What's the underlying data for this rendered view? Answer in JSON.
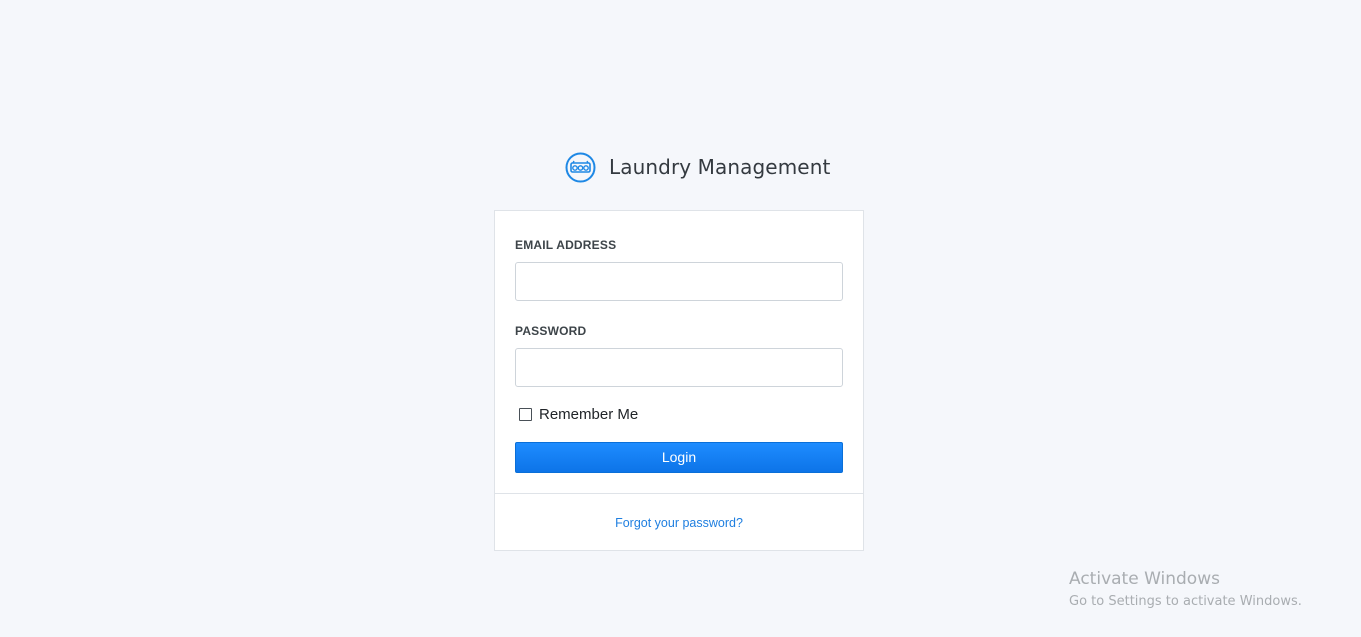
{
  "brand": {
    "title": "Laundry Management",
    "logo_icon": "washing-machine-icon",
    "accent_color": "#1e88e5"
  },
  "login_form": {
    "email_label": "EMAIL ADDRESS",
    "email_value": "",
    "password_label": "PASSWORD",
    "password_value": "",
    "remember_label": "Remember Me",
    "remember_checked": false,
    "login_label": "Login",
    "button_color": "#1a82f7"
  },
  "footer": {
    "forgot_label": "Forgot your password?",
    "link_color": "#1f7fe0"
  },
  "watermark": {
    "title": "Activate Windows",
    "subtitle": "Go to Settings to activate Windows."
  }
}
